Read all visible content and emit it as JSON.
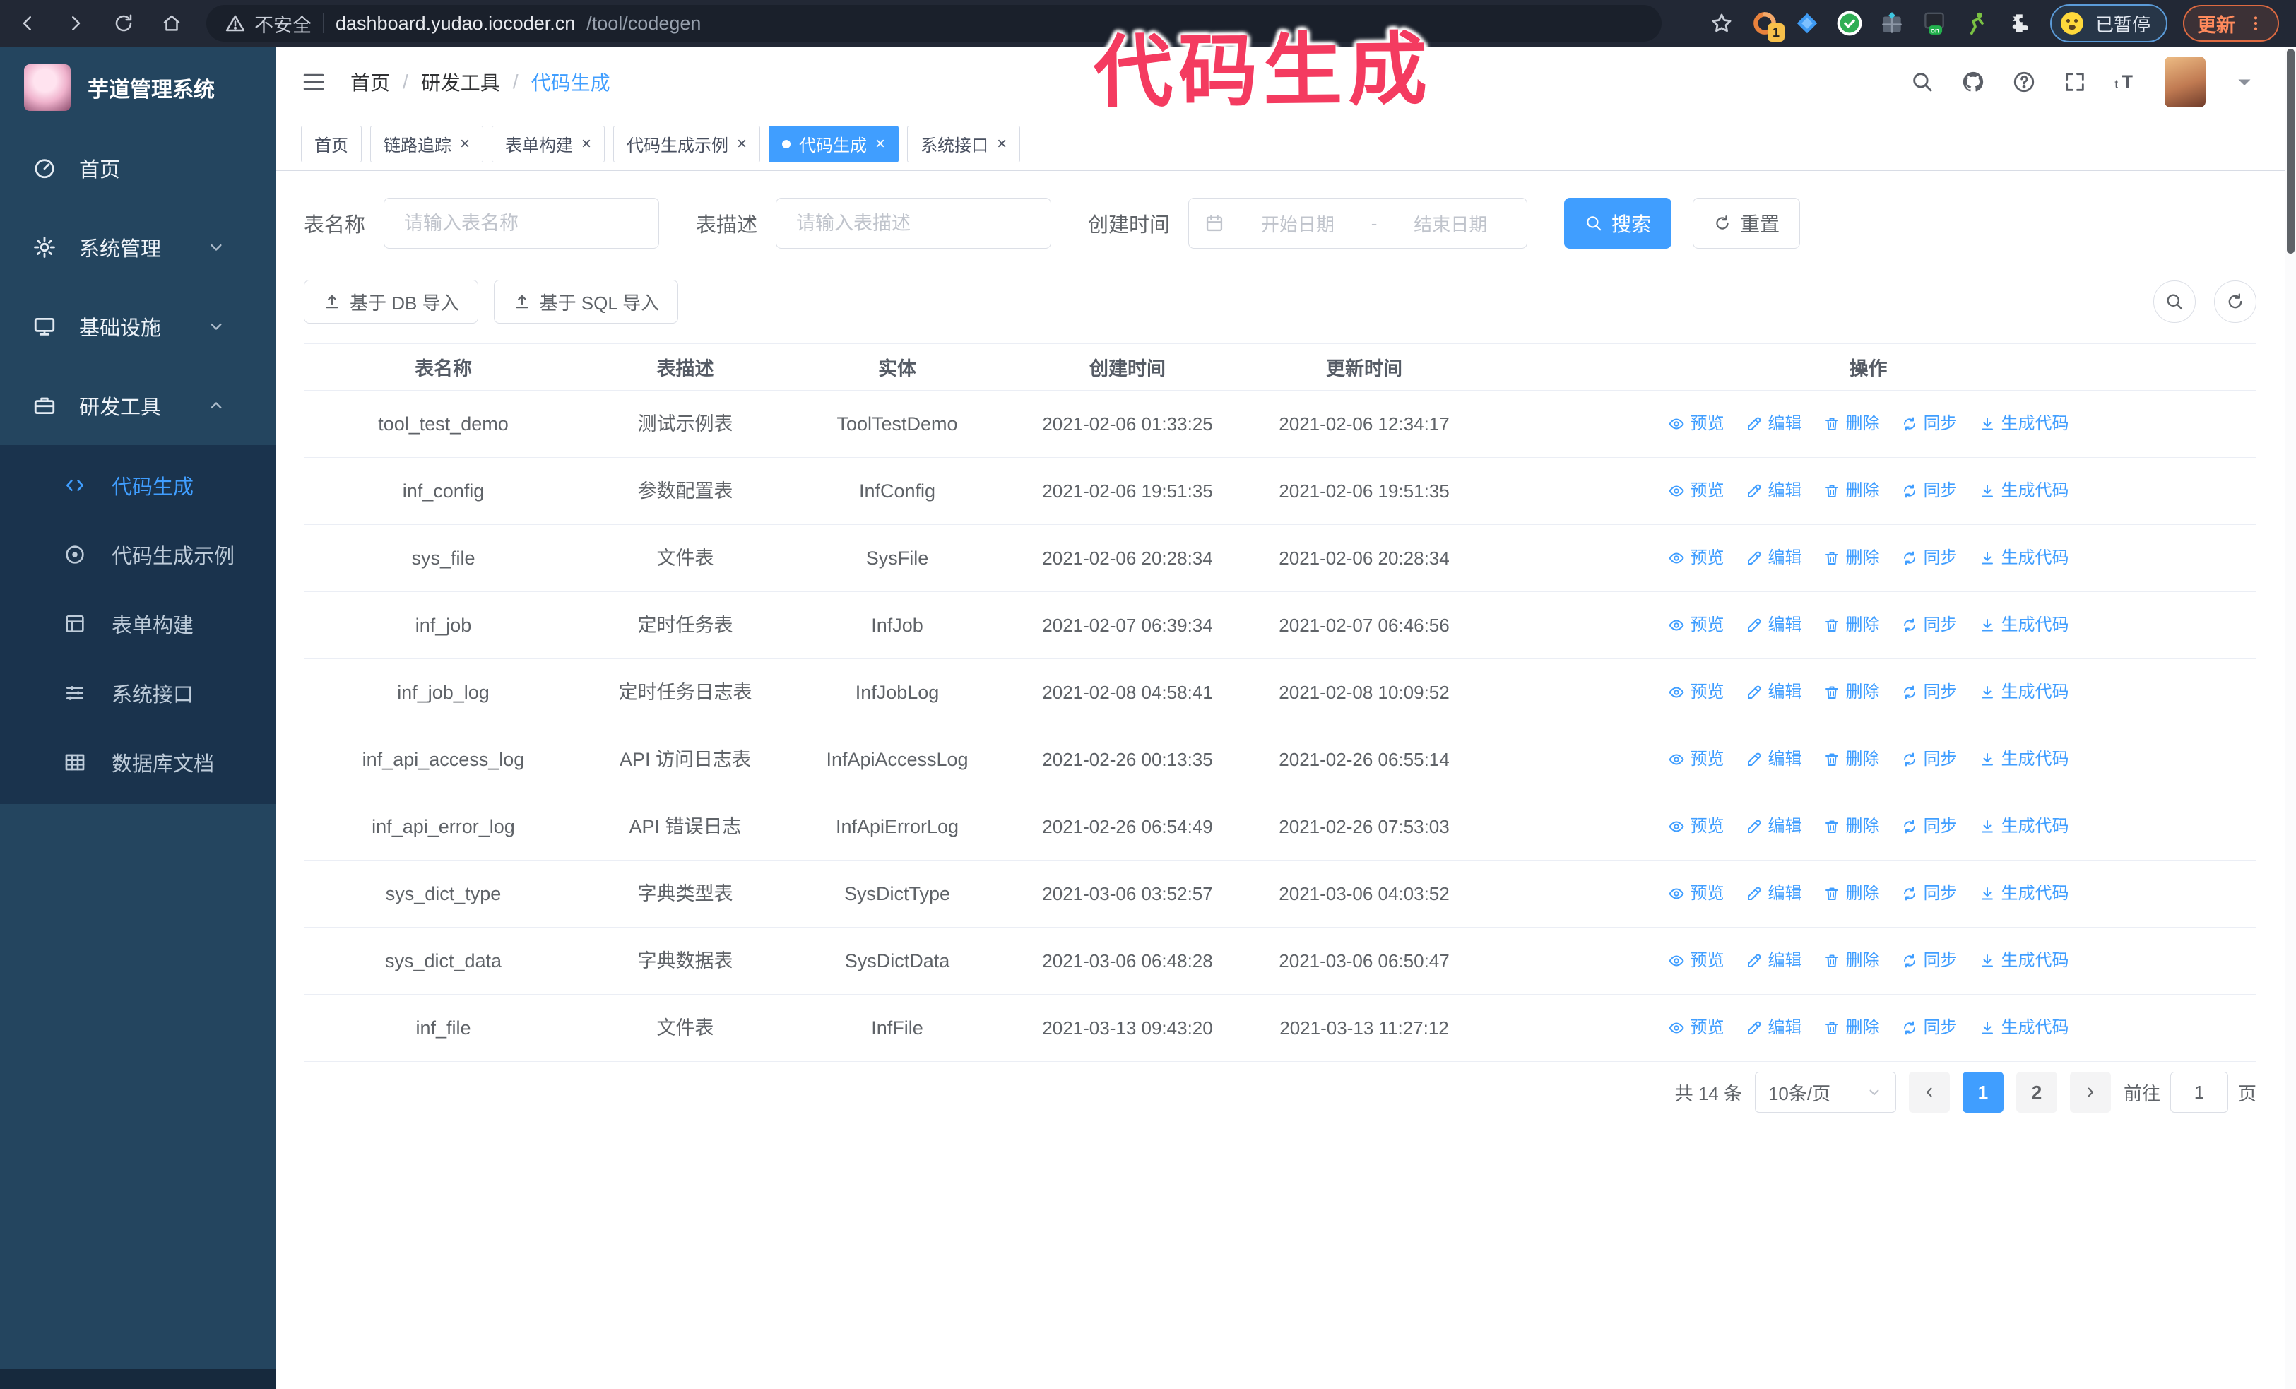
{
  "colors": {
    "primary": "#409eff",
    "overlay": "#f43b60",
    "sidebar_bg": "#24455f",
    "submenu_bg": "#1a334d",
    "browser_bg": "#222835"
  },
  "overlay_title": "代码生成",
  "browser": {
    "nav_icons": [
      "back-icon",
      "forward-icon",
      "reload-icon",
      "home-icon"
    ],
    "security_warning": "不安全",
    "url_host": "dashboard.yudao.iocoder.cn",
    "url_path": "/tool/codegen",
    "bookmark_icon": "star-icon",
    "extensions": [
      {
        "id": "ext-orange",
        "icon": "ext-orange-icon",
        "badge": "1"
      },
      {
        "id": "ext-gem",
        "icon": "ext-gem-icon",
        "badge": ""
      },
      {
        "id": "ext-check",
        "icon": "ext-check-icon",
        "badge": ""
      },
      {
        "id": "ext-grid",
        "icon": "ext-grid-icon",
        "badge": ""
      },
      {
        "id": "ext-dark",
        "icon": "ext-dark-icon",
        "badge": ""
      },
      {
        "id": "ext-green",
        "icon": "ext-green-icon",
        "badge": ""
      },
      {
        "id": "ext-puzzle",
        "icon": "ext-puzzle-icon",
        "badge": ""
      }
    ],
    "profile_chip": {
      "label": "已暂停",
      "icon": "emoji-face-icon"
    },
    "update_button": {
      "label": "更新",
      "menu_icon": "more-vert-icon"
    }
  },
  "sidebar": {
    "app_title": "芋道管理系统",
    "items": [
      {
        "id": "home",
        "label": "首页",
        "icon": "dashboard-icon",
        "group": false,
        "chevron": ""
      },
      {
        "id": "system-admin",
        "label": "系统管理",
        "icon": "gear-icon",
        "group": true,
        "chevron": "down"
      },
      {
        "id": "infrastructure",
        "label": "基础设施",
        "icon": "monitor-icon",
        "group": true,
        "chevron": "down"
      },
      {
        "id": "dev-tools",
        "label": "研发工具",
        "icon": "briefcase-icon",
        "group": true,
        "chevron": "up"
      }
    ],
    "submenu": [
      {
        "id": "codegen",
        "label": "代码生成",
        "icon": "code-icon",
        "active": true
      },
      {
        "id": "codegen-example",
        "label": "代码生成示例",
        "icon": "target-icon",
        "active": false
      },
      {
        "id": "form-builder",
        "label": "表单构建",
        "icon": "form-icon",
        "active": false
      },
      {
        "id": "system-api",
        "label": "系统接口",
        "icon": "sliders-icon",
        "active": false
      },
      {
        "id": "db-doc",
        "label": "数据库文档",
        "icon": "table-grid-icon",
        "active": false
      }
    ]
  },
  "navbar": {
    "hamburger_icon": "hamburger-icon",
    "breadcrumb": [
      "首页",
      "研发工具",
      "代码生成"
    ],
    "icons": [
      "search-icon",
      "github-icon",
      "question-icon",
      "fullscreen-icon",
      "fontsize-icon"
    ],
    "avatar_caret_icon": "caret-down-icon"
  },
  "tabs": [
    {
      "id": "home",
      "label": "首页",
      "closable": false,
      "active": false
    },
    {
      "id": "trace",
      "label": "链路追踪",
      "closable": true,
      "active": false
    },
    {
      "id": "form-builder",
      "label": "表单构建",
      "closable": true,
      "active": false
    },
    {
      "id": "codegen-example",
      "label": "代码生成示例",
      "closable": true,
      "active": false
    },
    {
      "id": "codegen",
      "label": "代码生成",
      "closable": true,
      "active": true
    },
    {
      "id": "system-api",
      "label": "系统接口",
      "closable": true,
      "active": false
    }
  ],
  "filters": {
    "table_name_label": "表名称",
    "table_name_placeholder": "请输入表名称",
    "table_desc_label": "表描述",
    "table_desc_placeholder": "请输入表描述",
    "create_time_label": "创建时间",
    "date_icon": "calendar-icon",
    "date_start_placeholder": "开始日期",
    "date_separator": "-",
    "date_end_placeholder": "结束日期",
    "search_button": {
      "label": "搜索",
      "icon": "search-icon"
    },
    "reset_button": {
      "label": "重置",
      "icon": "refresh-icon"
    }
  },
  "toolbar": {
    "import_db_button": {
      "label": "基于 DB 导入",
      "icon": "upload-icon"
    },
    "import_sql_button": {
      "label": "基于 SQL 导入",
      "icon": "upload-icon"
    },
    "circle_buttons": [
      {
        "id": "toggle-search",
        "icon": "search-icon"
      },
      {
        "id": "refresh-list",
        "icon": "refresh-icon"
      }
    ]
  },
  "table": {
    "columns": [
      "表名称",
      "表描述",
      "实体",
      "创建时间",
      "更新时间",
      "操作"
    ],
    "actions": [
      {
        "id": "preview",
        "label": "预览",
        "icon": "eye-icon"
      },
      {
        "id": "edit",
        "label": "编辑",
        "icon": "edit-icon"
      },
      {
        "id": "delete",
        "label": "删除",
        "icon": "delete-icon"
      },
      {
        "id": "sync",
        "label": "同步",
        "icon": "sync-icon"
      },
      {
        "id": "generate",
        "label": "生成代码",
        "icon": "download-icon"
      }
    ],
    "rows": [
      {
        "name": "tool_test_demo",
        "desc": "测试示例表",
        "entity": "ToolTestDemo",
        "create_time": "2021-02-06 01:33:25",
        "update_time": "2021-02-06 12:34:17"
      },
      {
        "name": "inf_config",
        "desc": "参数配置表",
        "entity": "InfConfig",
        "create_time": "2021-02-06 19:51:35",
        "update_time": "2021-02-06 19:51:35"
      },
      {
        "name": "sys_file",
        "desc": "文件表",
        "entity": "SysFile",
        "create_time": "2021-02-06 20:28:34",
        "update_time": "2021-02-06 20:28:34"
      },
      {
        "name": "inf_job",
        "desc": "定时任务表",
        "entity": "InfJob",
        "create_time": "2021-02-07 06:39:34",
        "update_time": "2021-02-07 06:46:56"
      },
      {
        "name": "inf_job_log",
        "desc": "定时任务日志表",
        "entity": "InfJobLog",
        "create_time": "2021-02-08 04:58:41",
        "update_time": "2021-02-08 10:09:52"
      },
      {
        "name": "inf_api_access_log",
        "desc": "API 访问日志表",
        "entity": "InfApiAccessLog",
        "create_time": "2021-02-26 00:13:35",
        "update_time": "2021-02-26 06:55:14"
      },
      {
        "name": "inf_api_error_log",
        "desc": "API 错误日志",
        "entity": "InfApiErrorLog",
        "create_time": "2021-02-26 06:54:49",
        "update_time": "2021-02-26 07:53:03"
      },
      {
        "name": "sys_dict_type",
        "desc": "字典类型表",
        "entity": "SysDictType",
        "create_time": "2021-03-06 03:52:57",
        "update_time": "2021-03-06 04:03:52"
      },
      {
        "name": "sys_dict_data",
        "desc": "字典数据表",
        "entity": "SysDictData",
        "create_time": "2021-03-06 06:48:28",
        "update_time": "2021-03-06 06:50:47"
      },
      {
        "name": "inf_file",
        "desc": "文件表",
        "entity": "InfFile",
        "create_time": "2021-03-13 09:43:20",
        "update_time": "2021-03-13 11:27:12"
      }
    ]
  },
  "pagination": {
    "total_label": "共 14 条",
    "page_size": "10条/页",
    "prev_icon": "chev-left-icon",
    "next_icon": "chev-right-icon",
    "pages": [
      "1",
      "2"
    ],
    "active_page": "1",
    "goto_label": "前往",
    "goto_value": "1",
    "goto_suffix": "页"
  }
}
